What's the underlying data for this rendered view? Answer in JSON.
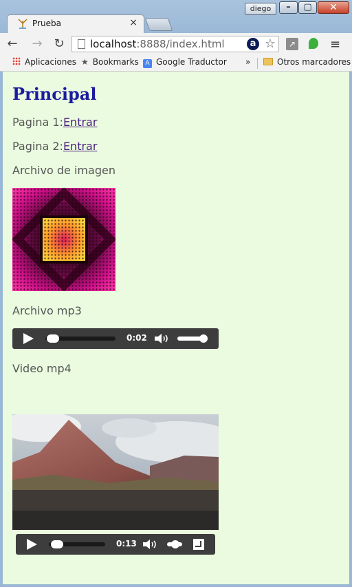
{
  "window": {
    "user": "diego",
    "min_glyph": "–",
    "max_glyph": "▢",
    "close_glyph": "✕"
  },
  "tab": {
    "title": "Prueba",
    "close_glyph": "×"
  },
  "toolbar": {
    "back_glyph": "←",
    "forward_glyph": "→",
    "reload_glyph": "↻",
    "url_host": "localhost",
    "url_rest": ":8888/index.html",
    "ext_a_label": "a",
    "star_glyph": "☆",
    "menu_glyph": "≡"
  },
  "bookmarks": {
    "apps": "Aplicaciones",
    "bookmarks": "Bookmarks",
    "translator": "Google Traductor",
    "overflow": "»",
    "other": "Otros marcadores",
    "translator_icon_letter": "A"
  },
  "page": {
    "title": "Principal",
    "page1_label": "Pagina 1:",
    "page1_link": "Entrar",
    "page2_label": "Pagina 2:",
    "page2_link": "Entrar",
    "image_label": "Archivo de imagen",
    "mp3_label": "Archivo mp3",
    "video_label": "Video mp4"
  },
  "audio_player": {
    "time": "0:02",
    "progress": 0.02,
    "volume": 1.0
  },
  "video_player": {
    "time": "0:13",
    "progress": 0.05,
    "volume": 0.6
  },
  "colors": {
    "page_bg": "#eafbe0",
    "title_color": "#1b1b9e",
    "link_color": "#4a1f7a",
    "player_bg": "#3d3d3d"
  },
  "icons": {
    "favicon": "antenna-icon",
    "page": "page-icon",
    "apps": "apps-grid-icon",
    "bookmark": "star-icon",
    "folder": "folder-icon",
    "play": "play-icon",
    "volume": "speaker-icon",
    "fullscreen": "fullscreen-icon"
  }
}
